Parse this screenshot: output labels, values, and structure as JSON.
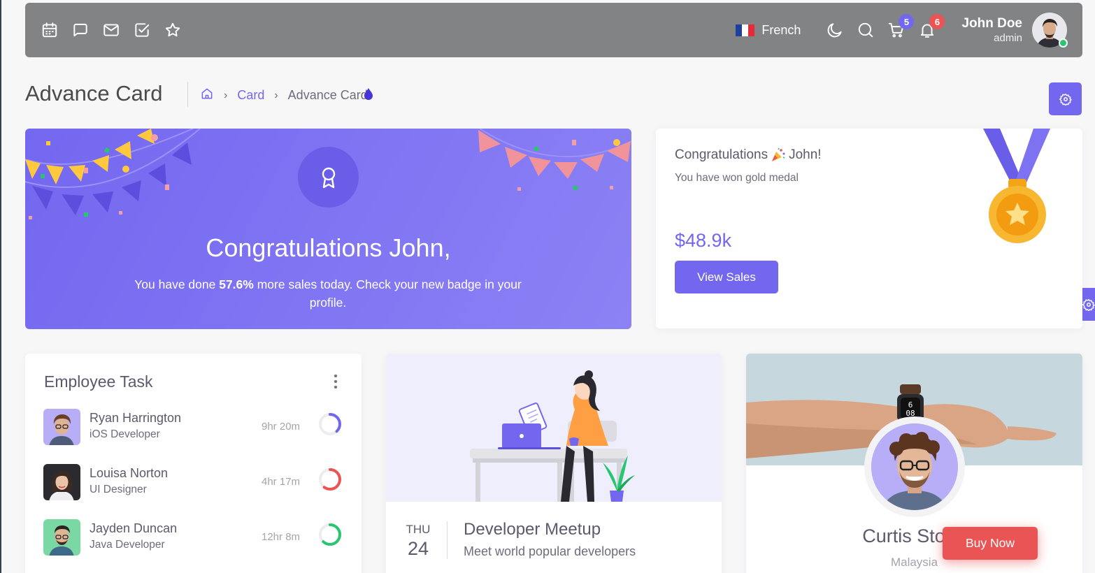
{
  "navbar": {
    "shortcut_icons": [
      "calendar-icon",
      "chat-icon",
      "mail-icon",
      "check-square-icon",
      "star-icon"
    ],
    "language": "French",
    "cart_badge": "5",
    "notification_badge": "6",
    "user_name": "John Doe",
    "user_role": "admin"
  },
  "header": {
    "title": "Advance Card",
    "breadcrumb": [
      "Card",
      "Advance Card"
    ]
  },
  "banner": {
    "title": "Congratulations John,",
    "text_before": "You have done ",
    "highlight": "57.6%",
    "text_after": " more sales today. Check your new badge in your profile."
  },
  "medal_card": {
    "title_part1": "Congratulations",
    "title_part2": "John!",
    "subtitle": "You have won gold medal",
    "amount": "$48.9k",
    "button": "View Sales"
  },
  "employee_task": {
    "title": "Employee Task",
    "rows": [
      {
        "name": "Ryan Harrington",
        "role": "iOS Developer",
        "time": "9hr 20m",
        "progress": 0.38,
        "color": "#7367f0"
      },
      {
        "name": "Louisa Norton",
        "role": "UI Designer",
        "time": "4hr 17m",
        "progress": 0.6,
        "color": "#ea5455"
      },
      {
        "name": "Jayden Duncan",
        "role": "Java Developer",
        "time": "12hr 8m",
        "progress": 0.62,
        "color": "#28c76f"
      }
    ]
  },
  "meetup": {
    "day": "THU",
    "date": "24",
    "title": "Developer Meetup",
    "subtitle": "Meet world popular developers"
  },
  "profile": {
    "name": "Curtis Stone",
    "location": "Malaysia",
    "button": "Buy Now"
  },
  "colors": {
    "primary": "#7367f0",
    "danger": "#ea5455",
    "success": "#28c76f",
    "gold": "#f7b731"
  }
}
